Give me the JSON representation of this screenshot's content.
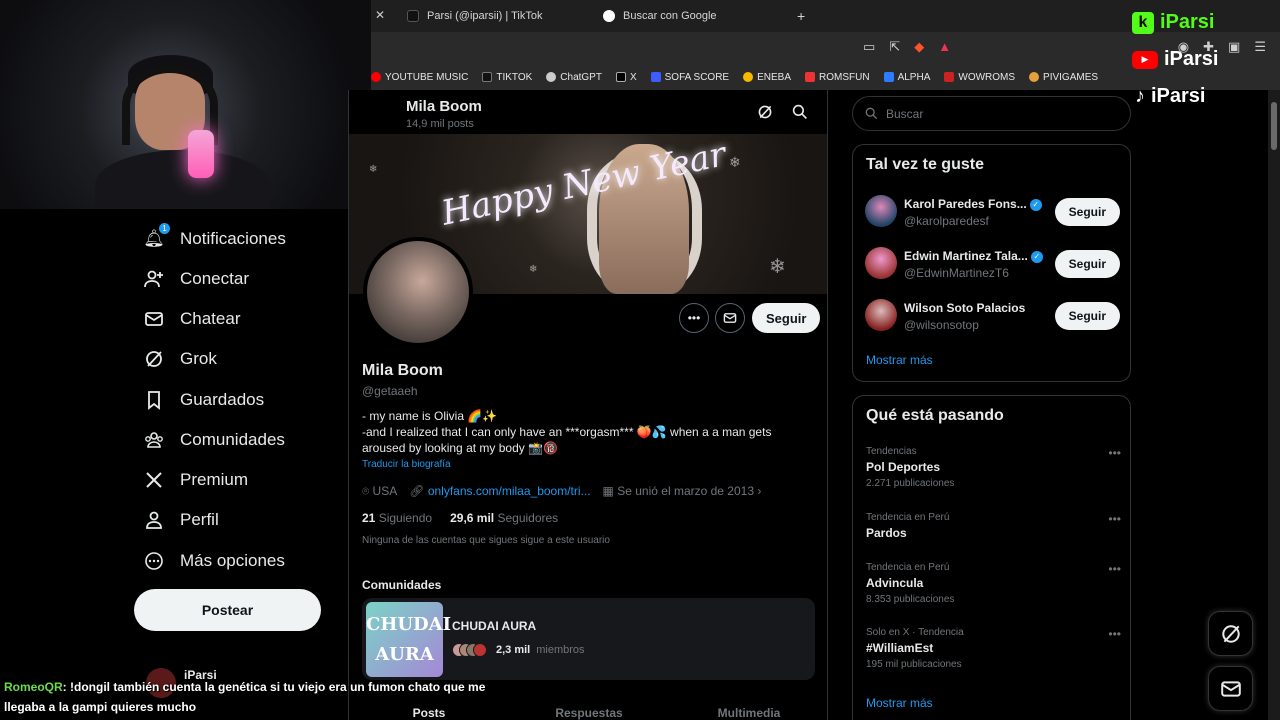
{
  "browser": {
    "tabs": [
      {
        "label": "Parsi (@iparsii) | TikTok"
      },
      {
        "label": "Buscar con Google"
      }
    ],
    "new_tab": "+",
    "bookmarks": [
      "YOUTUBE MUSIC",
      "TIKTOK",
      "ChatGPT",
      "X",
      "SOFA SCORE",
      "ENEBA",
      "ROMSFUN",
      "ALPHA",
      "WOWROMS",
      "PIVIGAMES"
    ]
  },
  "nav": {
    "notifications": "Notificaciones",
    "notifications_badge": "1",
    "connect": "Conectar",
    "chat": "Chatear",
    "grok": "Grok",
    "saved": "Guardados",
    "communities": "Comunidades",
    "premium": "Premium",
    "profile": "Perfil",
    "more": "Más opciones",
    "post_button": "Postear",
    "account_name": "iParsi"
  },
  "chat_overlay": {
    "user": "RomeoQR",
    "message": ": !dongil también cuenta la genética si tu viejo era un fumon chato que me llegaba a la gampi quieres mucho"
  },
  "profile": {
    "header_name": "Mila Boom",
    "header_posts": "14,9 mil posts",
    "banner_text": "Happy New Year",
    "follow_button": "Seguir",
    "name": "Mila Boom",
    "handle": "@getaaeh",
    "bio_line1": "- my name is Olivia 🌈✨",
    "bio_line2": "-and I realized that I can only have an ***orgasm*** 🍑💦 when a a man gets aroused by looking at my body 📸🔞",
    "translate": "Traducir la biografía",
    "location": "USA",
    "link": "onlyfans.com/milaa_boom/tri...",
    "joined": "Se unió el marzo de 2013",
    "following_count": "21",
    "following_label": "Siguiendo",
    "followers_count": "29,6 mil",
    "followers_label": "Seguidores",
    "no_mutuals": "Ninguna de las cuentas que sigues sigue a este usuario",
    "communities_title": "Comunidades",
    "community": {
      "name": "CHUDAI AURA",
      "image_text": "CHUDAI AURA",
      "members_count": "2,3 mil",
      "members_label": "miembros"
    },
    "tabs": [
      "Posts",
      "Respuestas",
      "Multimedia"
    ]
  },
  "right": {
    "search_placeholder": "Buscar",
    "suggestions_title": "Tal vez te guste",
    "suggestions": [
      {
        "name": "Karol Paredes Fons...",
        "handle": "@karolparedesf",
        "button": "Seguir",
        "verified": true
      },
      {
        "name": "Edwin Martinez Tala...",
        "handle": "@EdwinMartinezT6",
        "button": "Seguir",
        "verified": true
      },
      {
        "name": "Wilson Soto Palacios",
        "handle": "@wilsonsotop",
        "button": "Seguir",
        "verified": false
      }
    ],
    "show_more": "Mostrar más",
    "trends_title": "Qué está pasando",
    "trends": [
      {
        "category": "Tendencias",
        "title": "Pol Deportes",
        "count": "2.271 publicaciones"
      },
      {
        "category": "Tendencia en Perú",
        "title": "Pardos",
        "count": ""
      },
      {
        "category": "Tendencia en Perú",
        "title": "Advincula",
        "count": "8.353 publicaciones"
      },
      {
        "category": "Solo en X · Tendencia",
        "title": "#WilliamEst",
        "count": "195 mil publicaciones"
      }
    ],
    "trends_more": "Mostrar más"
  },
  "branding": {
    "kick": "iParsi",
    "youtube": "iParsi",
    "tiktok": "iParsi"
  },
  "colors": {
    "accent": "#1d9bf0",
    "kick_green": "#53fc18",
    "youtube_red": "#ff0000"
  }
}
